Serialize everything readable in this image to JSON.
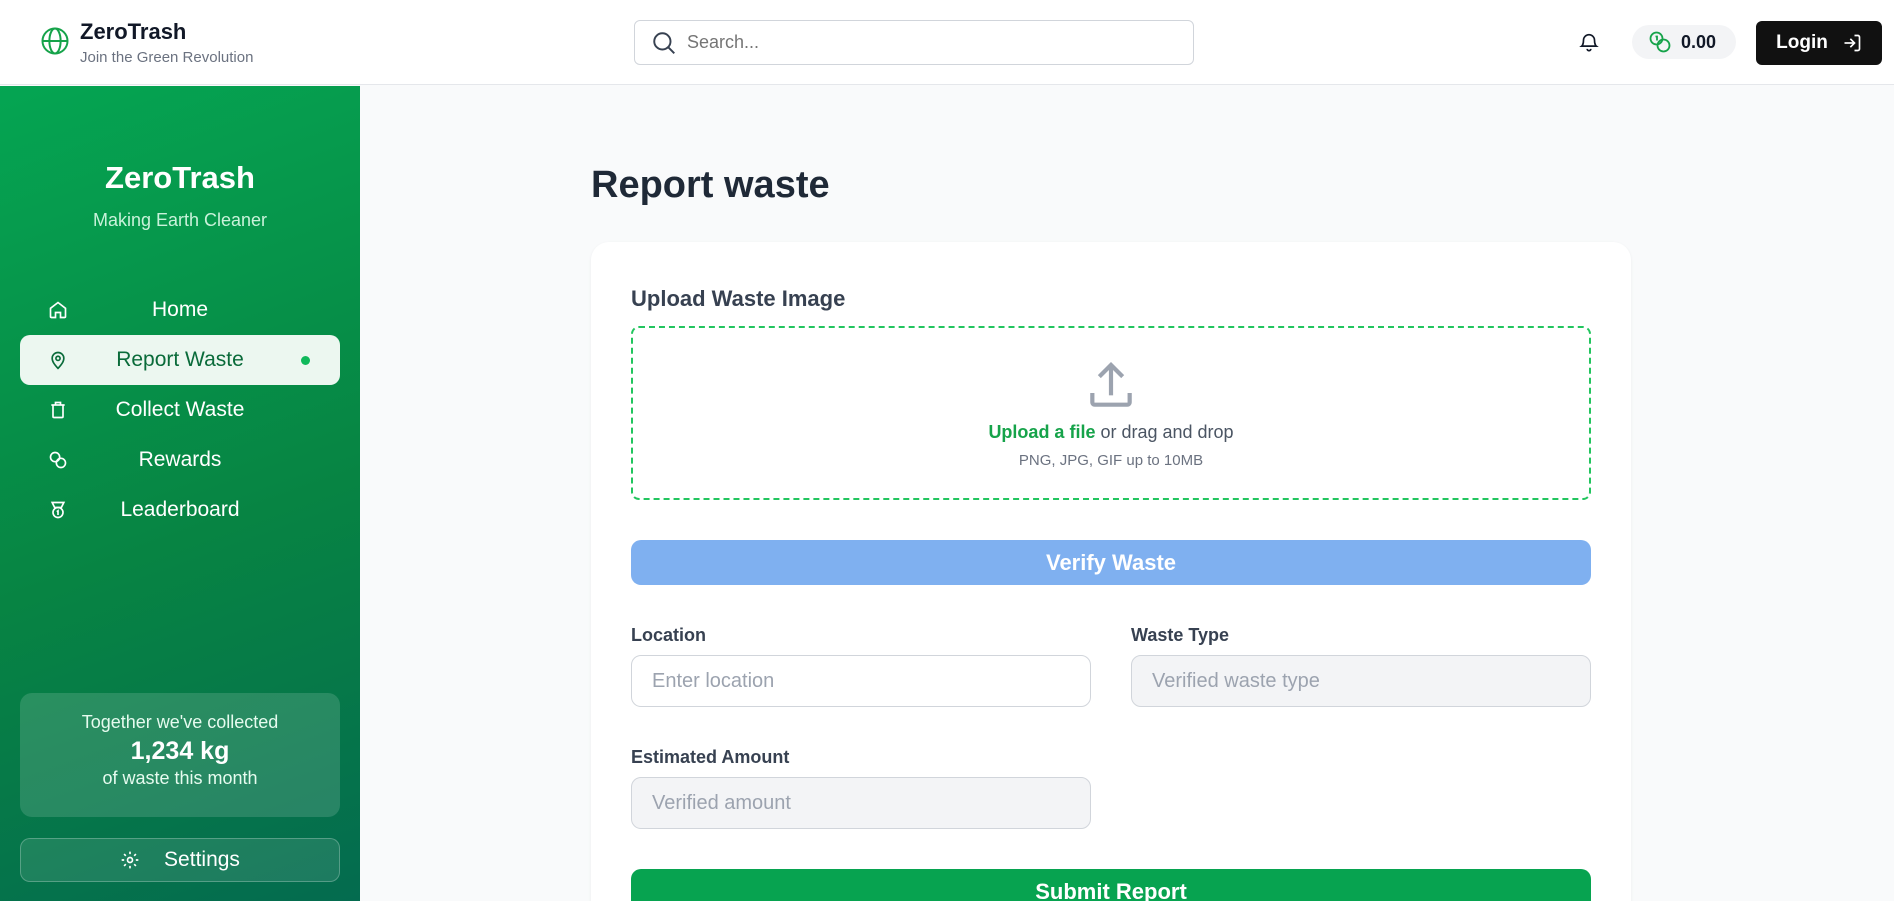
{
  "header": {
    "brand_title": "ZeroTrash",
    "brand_subtitle": "Join the Green Revolution",
    "search_placeholder": "Search...",
    "balance": "0.00",
    "login_label": "Login"
  },
  "sidebar": {
    "title": "ZeroTrash",
    "subtitle": "Making Earth Cleaner",
    "items": [
      {
        "label": "Home",
        "icon": "home-icon"
      },
      {
        "label": "Report Waste",
        "icon": "map-pin-icon",
        "active": true
      },
      {
        "label": "Collect Waste",
        "icon": "trash-icon"
      },
      {
        "label": "Rewards",
        "icon": "coins-icon"
      },
      {
        "label": "Leaderboard",
        "icon": "medal-icon"
      }
    ],
    "stats": {
      "line1": "Together we've collected",
      "amount": "1,234 kg",
      "line3": "of waste this month"
    },
    "settings_label": "Settings"
  },
  "main": {
    "title": "Report waste",
    "upload_label": "Upload Waste Image",
    "upload_link": "Upload a file",
    "upload_text": " or drag and drop",
    "upload_hint": "PNG, JPG, GIF up to 10MB",
    "verify_label": "Verify Waste",
    "location_label": "Location",
    "location_placeholder": "Enter location",
    "waste_type_label": "Waste Type",
    "waste_type_placeholder": "Verified waste type",
    "amount_label": "Estimated Amount",
    "amount_placeholder": "Verified amount",
    "submit_label": "Submit Report"
  },
  "colors": {
    "accent": "#07a350",
    "sidebar_start": "#05a552",
    "sidebar_end": "#046b4f",
    "verify_button": "#7fb0f0"
  }
}
